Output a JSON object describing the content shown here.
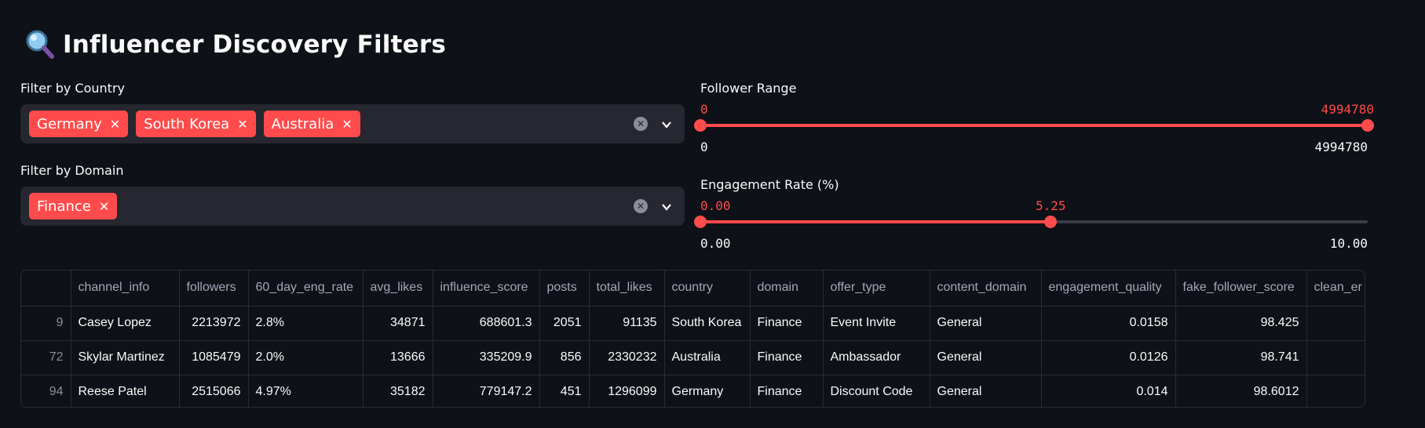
{
  "page": {
    "title": "Influencer Discovery Filters"
  },
  "country_filter": {
    "label": "Filter by Country",
    "tags": [
      "Germany",
      "South Korea",
      "Australia"
    ]
  },
  "domain_filter": {
    "label": "Filter by Domain",
    "tags": [
      "Finance"
    ]
  },
  "follower_range": {
    "label": "Follower Range",
    "selected_low": "0",
    "selected_high": "4994780",
    "min": "0",
    "max": "4994780",
    "low_fraction": 0,
    "high_fraction": 1
  },
  "engagement_rate": {
    "label": "Engagement Rate (%)",
    "selected_low": "0.00",
    "selected_high": "5.25",
    "min": "0.00",
    "max": "10.00",
    "low_fraction": 0,
    "high_fraction": 0.525
  },
  "table": {
    "columns": [
      "",
      "channel_info",
      "followers",
      "60_day_eng_rate",
      "avg_likes",
      "influence_score",
      "posts",
      "total_likes",
      "country",
      "domain",
      "offer_type",
      "content_domain",
      "engagement_quality",
      "fake_follower_score",
      "clean_er"
    ],
    "rows": [
      [
        "9",
        "Casey Lopez",
        "2213972",
        "2.8%",
        "34871",
        "688601.3",
        "2051",
        "91135",
        "South Korea",
        "Finance",
        "Event Invite",
        "General",
        "0.0158",
        "98.425",
        ""
      ],
      [
        "72",
        "Skylar Martinez",
        "1085479",
        "2.0%",
        "13666",
        "335209.9",
        "856",
        "2330232",
        "Australia",
        "Finance",
        "Ambassador",
        "General",
        "0.0126",
        "98.741",
        ""
      ],
      [
        "94",
        "Reese Patel",
        "2515066",
        "4.97%",
        "35182",
        "779147.2",
        "451",
        "1296099",
        "Germany",
        "Finance",
        "Discount Code",
        "General",
        "0.014",
        "98.6012",
        ""
      ]
    ]
  }
}
